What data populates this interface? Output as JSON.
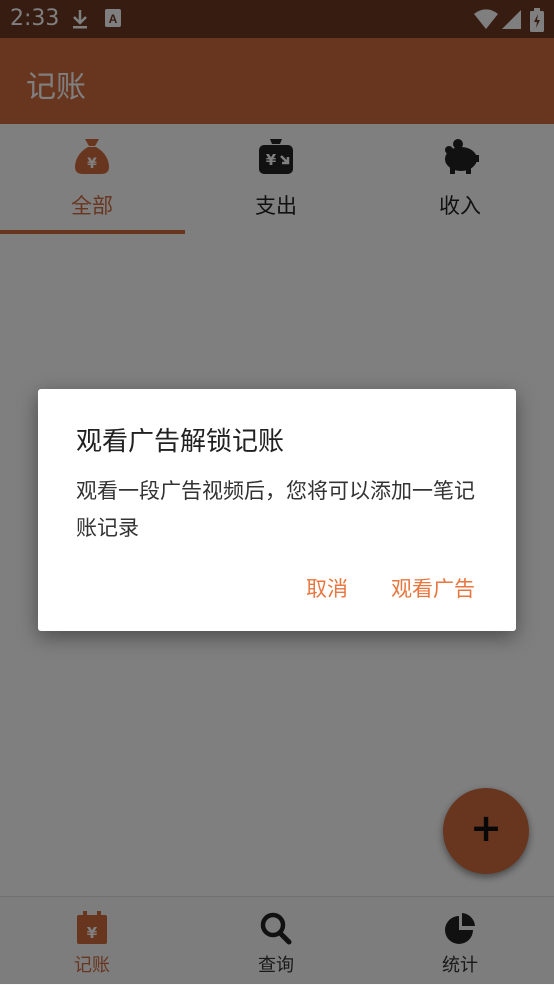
{
  "status_bar": {
    "time": "2:33"
  },
  "app_bar": {
    "title": "记账"
  },
  "tabs": [
    {
      "label": "全部",
      "icon": "money-bag-icon"
    },
    {
      "label": "支出",
      "icon": "wallet-expense-icon"
    },
    {
      "label": "收入",
      "icon": "piggy-bank-icon"
    }
  ],
  "fab": {
    "label": "+"
  },
  "bottom_nav": [
    {
      "label": "记账",
      "icon": "calendar-yen-icon"
    },
    {
      "label": "查询",
      "icon": "search-icon"
    },
    {
      "label": "统计",
      "icon": "pie-chart-icon"
    }
  ],
  "dialog": {
    "title": "观看广告解锁记账",
    "message": "观看一段广告视频后，您将可以添加一笔记账记录",
    "cancel_label": "取消",
    "confirm_label": "观看广告"
  },
  "colors": {
    "primary": "#d06b3e",
    "status_bar": "#6f3824",
    "dialog_button": "#e8763f",
    "scrim": "rgba(0,0,0,0.5)"
  }
}
